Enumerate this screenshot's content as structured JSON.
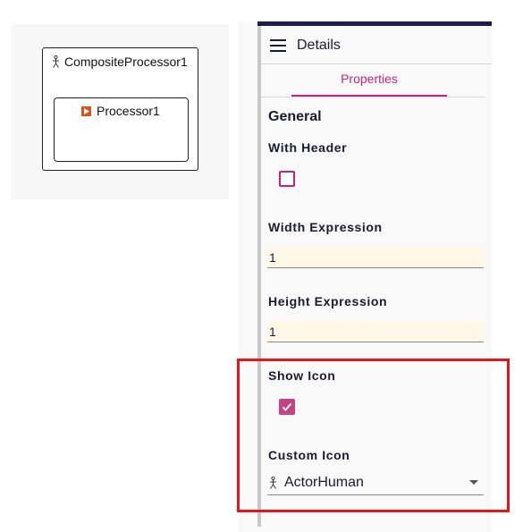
{
  "canvas": {
    "composite": {
      "label": "CompositeProcessor1",
      "icon": "actor-human-icon"
    },
    "processor": {
      "label": "Processor1",
      "icon": "play-icon",
      "icon_color": "#d9531e"
    }
  },
  "panel": {
    "title": "Details",
    "tab": "Properties",
    "section": "General",
    "with_header": {
      "label": "With Header",
      "checked": false
    },
    "width_expression": {
      "label": "Width Expression",
      "value": "1"
    },
    "height_expression": {
      "label": "Height Expression",
      "value": "1"
    },
    "show_icon": {
      "label": "Show Icon",
      "checked": true
    },
    "custom_icon": {
      "label": "Custom Icon",
      "value": "ActorHuman",
      "icon": "actor-human-icon"
    }
  },
  "colors": {
    "accent": "#c2257f",
    "header_bar": "#1e1a4f",
    "input_bg": "#fff8e6",
    "highlight": "#e3161e"
  }
}
